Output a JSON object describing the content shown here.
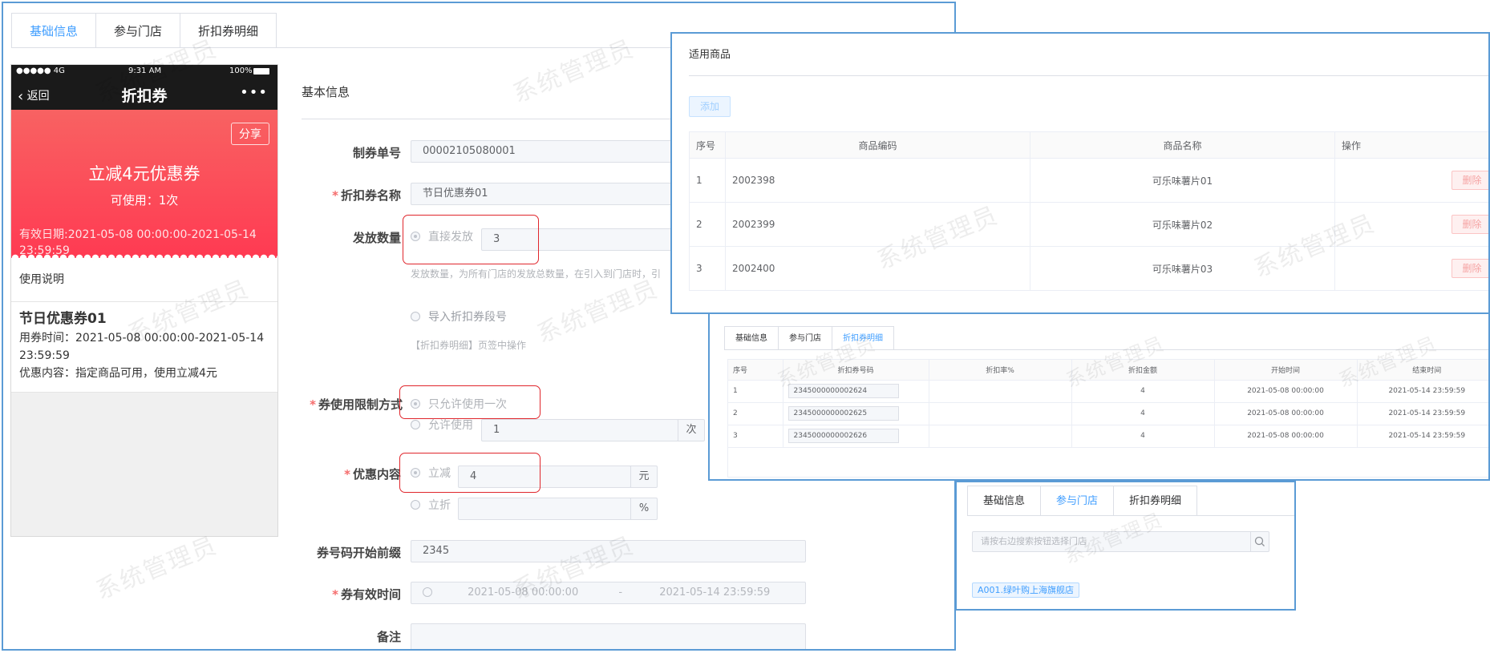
{
  "watermark": "系统管理员",
  "main": {
    "tabs": [
      {
        "label": "基础信息",
        "active": true
      },
      {
        "label": "参与门店",
        "active": false
      },
      {
        "label": "折扣券明细",
        "active": false
      }
    ]
  },
  "phone": {
    "status": {
      "signal": "●●●●● 4G",
      "time": "9:31 AM",
      "battery": "100%"
    },
    "nav": {
      "back": "返回",
      "title": "折扣券",
      "more": "•••"
    },
    "coupon": {
      "share": "分享",
      "title": "立减4元优惠券",
      "usable_times": "可使用：1次",
      "valid": "有效日期:2021-05-08 00:00:00-2021-05-14 23:59:59"
    },
    "usage_title": "使用说明",
    "detail": {
      "name": "节日优惠券01",
      "use_time": "用券时间：2021-05-08 00:00:00-2021-05-14 23:59:59",
      "content": "优惠内容：指定商品可用，使用立减4元"
    }
  },
  "form": {
    "section_title": "基本信息",
    "order_no": {
      "label": "制券单号",
      "value": "00002105080001"
    },
    "coupon_name": {
      "label": "折扣券名称",
      "value": "节日优惠券01"
    },
    "issue_qty": {
      "label": "发放数量",
      "direct_option": "直接发放",
      "direct_value": "3",
      "hint": "发放数量，为所有门店的发放总数量，在引入到门店时，引",
      "import_option": "导入折扣券段号",
      "import_hint": "【折扣券明细】页签中操作"
    },
    "use_limit": {
      "label": "券使用限制方式",
      "once_option": "只允许使用一次",
      "allow_option": "允许使用",
      "allow_value": "1",
      "allow_unit": "次"
    },
    "discount": {
      "label": "优惠内容",
      "reduce_option": "立减",
      "reduce_value": "4",
      "reduce_unit": "元",
      "rate_option": "立折",
      "rate_value": "",
      "rate_unit": "%"
    },
    "code_prefix": {
      "label": "券号码开始前缀",
      "value": "2345"
    },
    "valid_time": {
      "label": "券有效时间",
      "start": "2021-05-08 00:00:00",
      "sep": "-",
      "end": "2021-05-14 23:59:59"
    },
    "remark": {
      "label": "备注",
      "value": ""
    }
  },
  "goods": {
    "title": "适用商品",
    "add_button": "添加",
    "columns": [
      "序号",
      "商品编码",
      "商品名称",
      "操作"
    ],
    "delete_label": "删除",
    "rows": [
      {
        "no": "1",
        "code": "2002398",
        "name": "可乐味薯片01"
      },
      {
        "no": "2",
        "code": "2002399",
        "name": "可乐味薯片02"
      },
      {
        "no": "3",
        "code": "2002400",
        "name": "可乐味薯片03"
      }
    ]
  },
  "details": {
    "tabs": [
      {
        "label": "基础信息",
        "active": false
      },
      {
        "label": "参与门店",
        "active": false
      },
      {
        "label": "折扣券明细",
        "active": true
      }
    ],
    "columns": [
      "序号",
      "折扣券号码",
      "折扣率%",
      "折扣金额",
      "开始时间",
      "结束时间"
    ],
    "rows": [
      {
        "no": "1",
        "code": "2345000000002624",
        "rate": "",
        "amount": "4",
        "start": "2021-05-08 00:00:00",
        "end": "2021-05-14 23:59:59"
      },
      {
        "no": "2",
        "code": "2345000000002625",
        "rate": "",
        "amount": "4",
        "start": "2021-05-08 00:00:00",
        "end": "2021-05-14 23:59:59"
      },
      {
        "no": "3",
        "code": "2345000000002626",
        "rate": "",
        "amount": "4",
        "start": "2021-05-08 00:00:00",
        "end": "2021-05-14 23:59:59"
      }
    ]
  },
  "stores": {
    "tabs": [
      {
        "label": "基础信息",
        "active": false
      },
      {
        "label": "参与门店",
        "active": true
      },
      {
        "label": "折扣券明细",
        "active": false
      }
    ],
    "search_placeholder": "请按右边搜索按钮选择门店",
    "store_tag": "A001.绿叶购上海旗舰店"
  }
}
